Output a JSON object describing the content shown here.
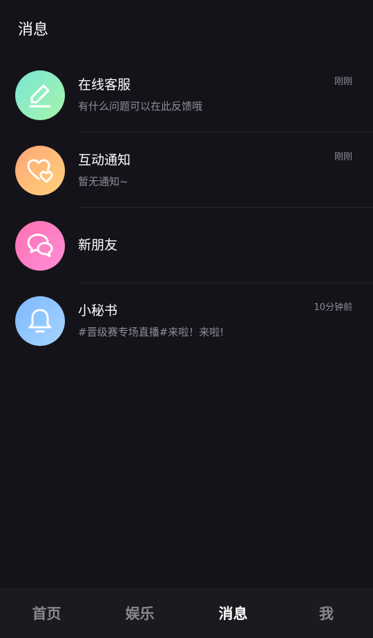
{
  "header": {
    "title": "消息"
  },
  "messages": [
    {
      "name": "在线客服",
      "preview": "有什么问题可以在此反馈哦",
      "time": "刚刚",
      "icon": "edit-icon",
      "gradient": [
        "#7ae6d6",
        "#a6f5a8"
      ]
    },
    {
      "name": "互动通知",
      "preview": "暂无通知~",
      "time": "刚刚",
      "icon": "hearts-icon",
      "gradient": [
        "#ffa577",
        "#ffd37a"
      ]
    },
    {
      "name": "新朋友",
      "icon": "chat-bubbles-icon",
      "gradient": [
        "#ff6fb1",
        "#ff8fd9"
      ]
    },
    {
      "name": "小秘书",
      "preview": "#晋级赛专场直播#来啦！来啦!",
      "time": "10分钟前",
      "icon": "bell-icon",
      "gradient": [
        "#7db9ff",
        "#a6d4ff"
      ]
    }
  ],
  "tabbar": {
    "tabs": [
      {
        "label": "首页",
        "active": false
      },
      {
        "label": "娱乐",
        "active": false
      },
      {
        "label": "消息",
        "active": true
      },
      {
        "label": "我",
        "active": false
      }
    ]
  },
  "colors": {
    "background": "#15131a",
    "tabbar": "#1b1a1f",
    "text_secondary": "#8f8c96"
  }
}
